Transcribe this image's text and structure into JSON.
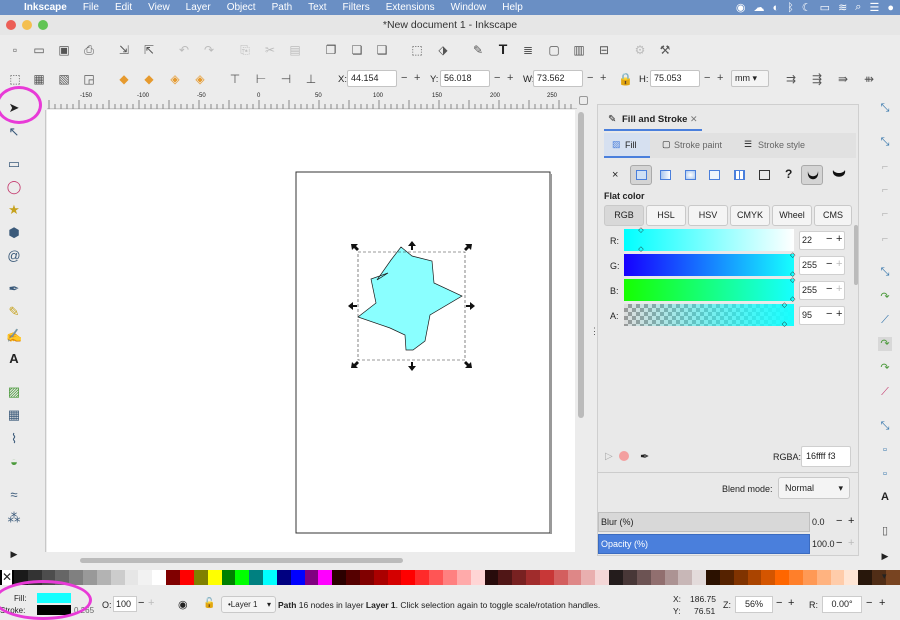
{
  "menubar": {
    "app_name": "Inkscape",
    "items": [
      "File",
      "Edit",
      "View",
      "Layer",
      "Object",
      "Path",
      "Text",
      "Filters",
      "Extensions",
      "Window",
      "Help"
    ]
  },
  "window": {
    "title": "*New document 1 - Inkscape"
  },
  "tool_controls": {
    "x_label": "X:",
    "x_value": "44.154",
    "y_label": "Y:",
    "y_value": "56.018",
    "w_label": "W:",
    "w_value": "73.562",
    "h_label": "H:",
    "h_value": "75.053",
    "unit": "mm"
  },
  "ruler": {
    "ticks": [
      "-150",
      "-100",
      "-50",
      "0",
      "50",
      "100",
      "150",
      "200",
      "250"
    ]
  },
  "fill_stroke": {
    "tab_title": "Fill and Stroke",
    "tabs": [
      "Fill",
      "Stroke paint",
      "Stroke style"
    ],
    "paint_types": {
      "none": "×",
      "unset": "?"
    },
    "flat_color_label": "Flat color",
    "modes": [
      "RGB",
      "HSL",
      "HSV",
      "CMYK",
      "Wheel",
      "CMS"
    ],
    "channels": [
      {
        "label": "R:",
        "value": "22",
        "level": 0.086
      },
      {
        "label": "G:",
        "value": "255",
        "level": 1.0
      },
      {
        "label": "B:",
        "value": "255",
        "level": 1.0
      },
      {
        "label": "A:",
        "value": "95",
        "level": 0.95
      }
    ],
    "rgba_label": "RGBA:",
    "rgba_value": "16ffff f3",
    "blend_label": "Blend mode:",
    "blend_value": "Normal",
    "blur_label": "Blur (%)",
    "blur_value": "0.0",
    "opacity_label": "Opacity (%)",
    "opacity_value": "100.0"
  },
  "statusbar": {
    "fill_label": "Fill:",
    "stroke_label": "Stroke:",
    "stroke_width": "0.265",
    "opacity_label": "O:",
    "opacity_value": "100",
    "layer": "•Layer 1",
    "message_bold1": "Path",
    "message_part1": " 16 nodes in layer ",
    "message_bold2": "Layer 1",
    "message_part2": ". Click selection again to toggle scale/rotation handles.",
    "cursor_x_label": "X:",
    "cursor_x": "186.75",
    "cursor_y_label": "Y:",
    "cursor_y": "76.51",
    "zoom_label": "Z:",
    "zoom_value": "56%",
    "rotation_label": "R:",
    "rotation_value": "0.00°"
  },
  "colors": {
    "fill": "#16ffff",
    "accent": "#4a7fdc",
    "annotation": "#e83ad7"
  },
  "palette": [
    "#000000",
    "#1a1a1a",
    "#333333",
    "#4d4d4d",
    "#666666",
    "#808080",
    "#999999",
    "#b3b3b3",
    "#cccccc",
    "#e6e6e6",
    "#f2f2f2",
    "#ffffff",
    "#800000",
    "#ff0000",
    "#808000",
    "#ffff00",
    "#008000",
    "#00ff00",
    "#008080",
    "#00ffff",
    "#000080",
    "#0000ff",
    "#800080",
    "#ff00ff",
    "#2b0000",
    "#550000",
    "#800000",
    "#aa0000",
    "#d40000",
    "#ff0000",
    "#ff2a2a",
    "#ff5555",
    "#ff8080",
    "#ffaaaa",
    "#ffd5d5",
    "#280b0b",
    "#501616",
    "#782121",
    "#a02c2c",
    "#c83737",
    "#d35f5f",
    "#de8787",
    "#e9afaf",
    "#f4d7d7",
    "#241c1c",
    "#483737",
    "#6c5353",
    "#916f6f",
    "#ac9393",
    "#c8b7b7",
    "#e3dbdb",
    "#2b1100",
    "#552200",
    "#803300",
    "#aa4400",
    "#d45500",
    "#ff6600",
    "#ff7f2a",
    "#ff9955",
    "#ffb380",
    "#ffccaa",
    "#ffe6d5",
    "#28170b",
    "#502d16",
    "#784421"
  ]
}
